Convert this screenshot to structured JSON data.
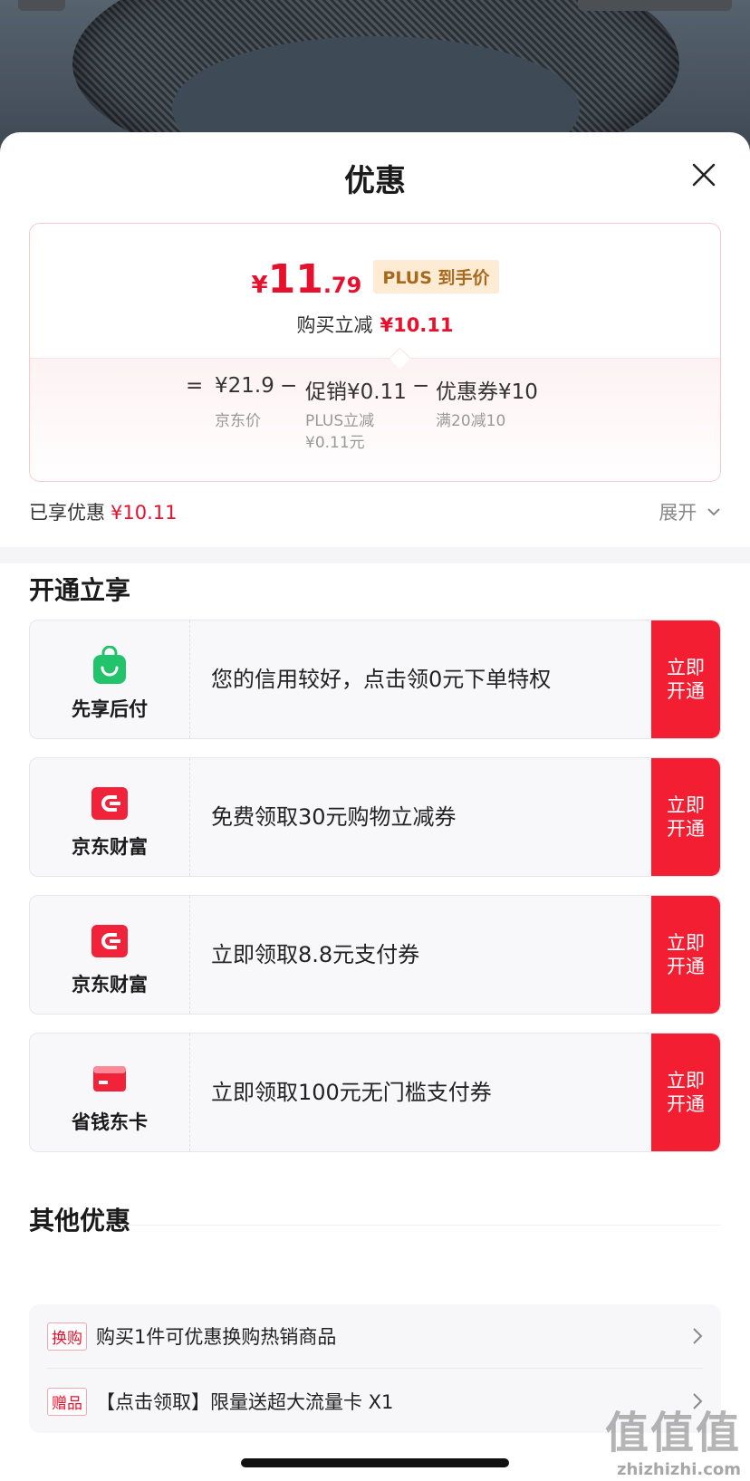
{
  "sheet": {
    "title": "优惠",
    "close_icon": "close-icon"
  },
  "price": {
    "currency": "¥",
    "integer": "11",
    "decimal": ".79",
    "tag": "PLUS 到手价",
    "discount_label": "购买立减",
    "discount_value": "¥10.11"
  },
  "formula": {
    "equals": "=",
    "base_price": "¥21.9",
    "minus1": "−",
    "promo": "促销¥0.11",
    "minus2": "−",
    "coupon": "优惠券¥10",
    "base_label": "京东价",
    "promo_sub1": "PLUS立减",
    "promo_sub2": "¥0.11元",
    "coupon_sub": "满20减10"
  },
  "enjoyed": {
    "label": "已享优惠",
    "value": "¥10.11",
    "expand": "展开"
  },
  "open_section": {
    "title": "开通立享",
    "offers": [
      {
        "name": "先享后付",
        "icon": "shopping-bag-icon",
        "desc": "您的信用较好，点击领0元下单特权",
        "button": "立即开通"
      },
      {
        "name": "京东财富",
        "icon": "jd-wallet-icon",
        "desc": "免费领取30元购物立减券",
        "button": "立即开通"
      },
      {
        "name": "京东财富",
        "icon": "jd-wallet-icon",
        "desc": "立即领取8.8元支付券",
        "button": "立即开通"
      },
      {
        "name": "省钱东卡",
        "icon": "bank-card-icon",
        "desc": "立即领取100元无门槛支付券",
        "button": "立即开通"
      }
    ]
  },
  "other_section": {
    "title": "其他优惠",
    "items": [
      {
        "tag": "换购",
        "text": "购买1件可优惠换购热销商品"
      },
      {
        "tag": "赠品",
        "text": "【点击领取】限量送超大流量卡 X1"
      }
    ]
  },
  "watermark": {
    "big": "值值值",
    "small": "zhizhizhi.com"
  },
  "colors": {
    "accent_red": "#f41e33",
    "price_red": "#e8112d",
    "plus_gold": "#a8691f",
    "green": "#22c36a"
  }
}
